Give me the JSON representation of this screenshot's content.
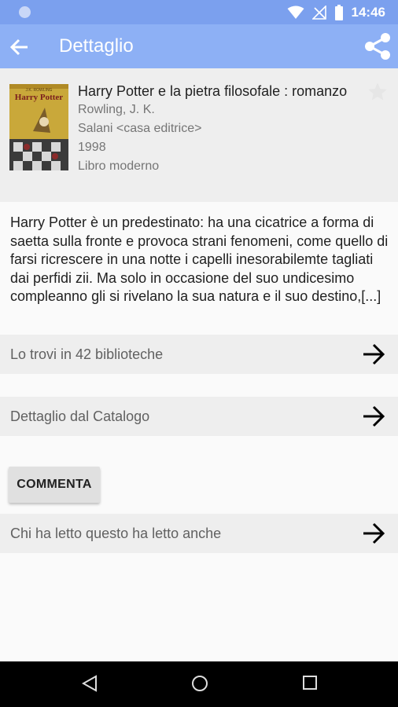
{
  "status_bar": {
    "time": "14:46"
  },
  "app_bar": {
    "title": "Dettaglio",
    "back_icon": "arrow-back-icon",
    "share_icon": "share-icon"
  },
  "book": {
    "title": "Harry Potter e la pietra filosofale : romanzo",
    "author": "Rowling, J. K.",
    "publisher": "Salani <casa editrice>",
    "year": "1998",
    "type": "Libro moderno",
    "cover_text": "Harry Potter",
    "cover_author": "J.K. ROWLING"
  },
  "description": "Harry Potter è un predestinato: ha una cicatrice a forma di saetta sulla fronte e provoca strani fenomeni, come quello di farsi ricrescere in una notte i capelli inesorabilemte tagliati dai perfidi zii. Ma solo in occasione del suo undicesimo compleanno gli si rivelano la sua natura e il suo destino,[...]",
  "rows": {
    "libraries": "Lo trovi in 42 biblioteche",
    "catalog": "Dettaglio dal Catalogo",
    "also_read": "Chi ha letto questo ha letto anche"
  },
  "comment_button": "COMMENTA",
  "colors": {
    "status_bar": "#7ba0ee",
    "app_bar": "#8db0f5",
    "row_bg": "#eeeeee"
  }
}
